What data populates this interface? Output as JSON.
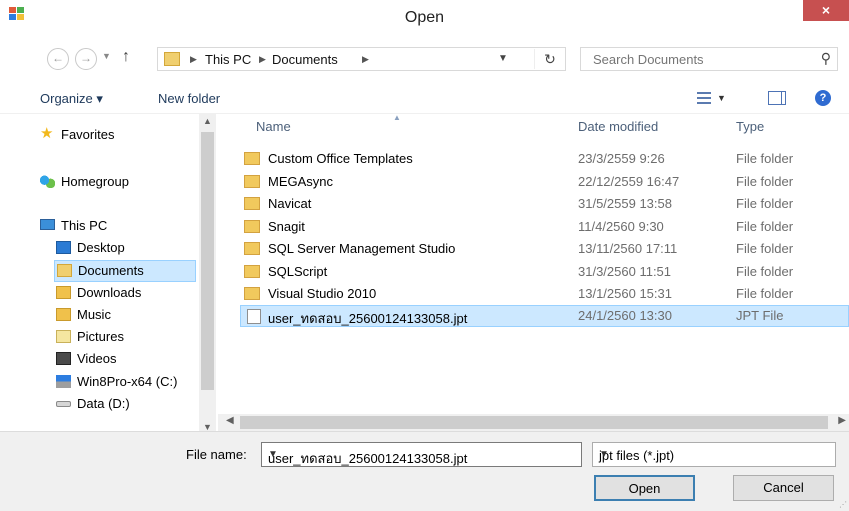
{
  "window": {
    "title": "Open",
    "close_label": "×"
  },
  "nav": {
    "back": "←",
    "forward": "→",
    "up": "↑",
    "breadcrumb": [
      "This PC",
      "Documents"
    ],
    "search_placeholder": "Search Documents"
  },
  "toolbar": {
    "organize": "Organize ▾",
    "new_folder": "New folder"
  },
  "sidebar": {
    "items": [
      {
        "label": "Favorites",
        "icon": "star-icon"
      },
      {
        "label": "Homegroup",
        "icon": "homegroup-icon"
      },
      {
        "label": "This PC",
        "icon": "computer-icon"
      },
      {
        "label": "Desktop",
        "icon": "desktop-icon"
      },
      {
        "label": "Documents",
        "icon": "documents-icon",
        "selected": true
      },
      {
        "label": "Downloads",
        "icon": "downloads-icon"
      },
      {
        "label": "Music",
        "icon": "music-icon"
      },
      {
        "label": "Pictures",
        "icon": "pictures-icon"
      },
      {
        "label": "Videos",
        "icon": "videos-icon"
      },
      {
        "label": "Win8Pro-x64 (C:)",
        "icon": "drive-c-icon"
      },
      {
        "label": "Data (D:)",
        "icon": "drive-d-icon"
      }
    ]
  },
  "filelist": {
    "columns": [
      "Name",
      "Date modified",
      "Type"
    ],
    "rows": [
      {
        "name": "Custom Office Templates",
        "date": "23/3/2559 9:26",
        "type": "File folder",
        "kind": "folder"
      },
      {
        "name": "MEGAsync",
        "date": "22/12/2559 16:47",
        "type": "File folder",
        "kind": "folder"
      },
      {
        "name": "Navicat",
        "date": "31/5/2559 13:58",
        "type": "File folder",
        "kind": "folder"
      },
      {
        "name": "Snagit",
        "date": "11/4/2560 9:30",
        "type": "File folder",
        "kind": "folder"
      },
      {
        "name": "SQL Server Management Studio",
        "date": "13/11/2560 17:11",
        "type": "File folder",
        "kind": "folder"
      },
      {
        "name": "SQLScript",
        "date": "31/3/2560 11:51",
        "type": "File folder",
        "kind": "folder"
      },
      {
        "name": "Visual Studio 2010",
        "date": "13/1/2560 15:31",
        "type": "File folder",
        "kind": "folder"
      },
      {
        "name": "user_ทดสอบ_25600124133058.jpt",
        "date": "24/1/2560 13:30",
        "type": "JPT File",
        "kind": "file",
        "selected": true
      }
    ]
  },
  "footer": {
    "file_name_label": "File name:",
    "file_name_value": "user_ทดสอบ_25600124133058.jpt",
    "file_type_value": "jpt files (*.jpt)",
    "open_label": "Open",
    "cancel_label": "Cancel"
  },
  "colors": {
    "selection": "#cce8ff",
    "selection_border": "#99d1ff",
    "close": "#c75050",
    "link": "#1e395b"
  }
}
